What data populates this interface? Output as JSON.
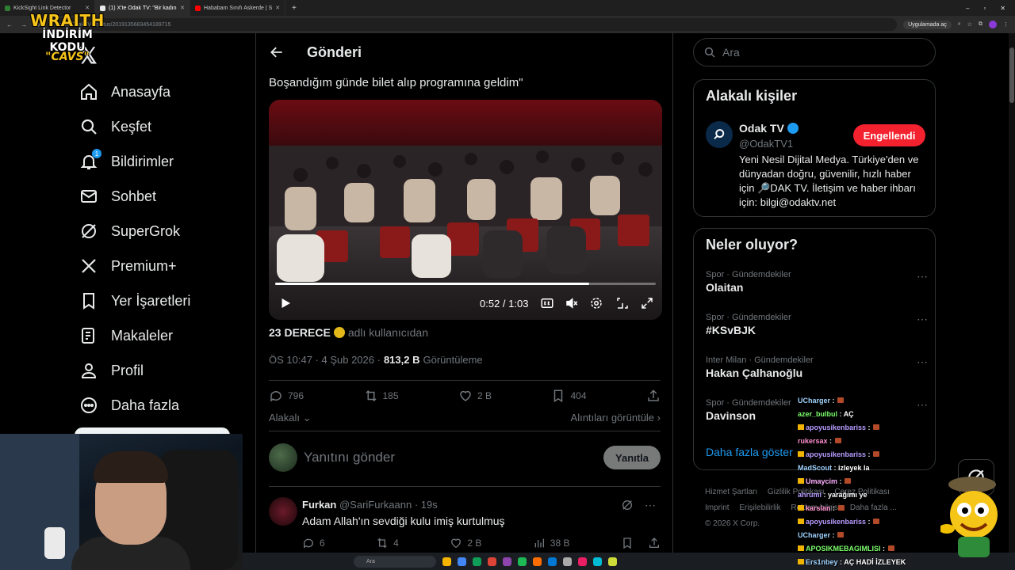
{
  "browser": {
    "tabs": [
      {
        "title": "KickSight Link Detector",
        "color": "#2e7d32",
        "active": false
      },
      {
        "title": "(1) X'te Odak TV: \"Bir kadın",
        "color": "#e7e9ea",
        "active": true
      },
      {
        "title": "Hababam Sınıfı Askerde | S",
        "color": "#ff0000",
        "active": false
      }
    ],
    "url": "x.com/OdakTV1/status/2019135683454189715",
    "app_pill": "Uygulamada aç"
  },
  "overlay_logo": {
    "line1": "WRAITH",
    "line2": "İNDİRİM KODU",
    "line3": "\"CAVS\""
  },
  "nav": {
    "items": [
      {
        "label": "Anasayfa",
        "icon": "home-icon"
      },
      {
        "label": "Keşfet",
        "icon": "search-icon"
      },
      {
        "label": "Bildirimler",
        "icon": "bell-icon",
        "badge": "1"
      },
      {
        "label": "Sohbet",
        "icon": "mail-icon"
      },
      {
        "label": "SuperGrok",
        "icon": "grok-icon"
      },
      {
        "label": "Premium+",
        "icon": "x-logo-icon"
      },
      {
        "label": "Yer İşaretleri",
        "icon": "bookmark-icon"
      },
      {
        "label": "Makaleler",
        "icon": "article-icon"
      },
      {
        "label": "Profil",
        "icon": "person-icon"
      },
      {
        "label": "Daha fazla",
        "icon": "more-circle-icon"
      }
    ]
  },
  "main": {
    "title": "Gönderi",
    "quote_line": "Boşandığım günde bilet alıp programına geldim\"",
    "video": {
      "current_time": "0:52",
      "duration": "1:03",
      "time_display": "0:52 / 1:03",
      "progress": 0.825
    },
    "attribution": {
      "name": "23 DERECE",
      "suffix": "adlı kullanıcıdan"
    },
    "meta": {
      "time": "ÖS 10:47 · 4 Şub 2026 ·",
      "views": "813,2 B",
      "views_label": "Görüntüleme"
    },
    "stats": {
      "replies": "796",
      "reposts": "185",
      "likes": "2 B",
      "bookmarks": "404"
    },
    "sort_label": "Alakalı",
    "quotes_link": "Alıntıları görüntüle",
    "reply_placeholder": "Yanıtını gönder",
    "reply_button": "Yanıtla",
    "comment": {
      "name": "Furkan",
      "handle": "@SariFurkaann · 19s",
      "text": "Adam Allah'ın sevdiği kulu imiş kurtulmuş",
      "replies": "6",
      "reposts": "4",
      "likes": "2 B",
      "views": "38 B"
    }
  },
  "right": {
    "search_placeholder": "Ara",
    "related": {
      "title": "Alakalı kişiler",
      "name": "Odak TV",
      "handle": "@OdakTV1",
      "button": "Engellendi",
      "bio": "Yeni Nesil Dijital Medya. Türkiye'den ve dünyadan doğru, güvenilir, hızlı haber için 🔎DAK TV. İletişim ve haber ihbarı için: bilgi@odaktv.net"
    },
    "trends": {
      "title": "Neler oluyor?",
      "items": [
        {
          "meta": "Spor · Gündemdekiler",
          "name": "Olaitan"
        },
        {
          "meta": "Spor · Gündemdekiler",
          "name": "#KSvBJK"
        },
        {
          "meta": "Inter Milan · Gündemdekiler",
          "name": "Hakan Çalhanoğlu"
        },
        {
          "meta": "Spor · Gündemdekiler",
          "name": "Davinson"
        }
      ],
      "show_more": "Daha fazla göster"
    },
    "footer": {
      "links": [
        "Hizmet Şartları",
        "Gizlilik Politikası",
        "Çerez Politikası",
        "Imprint",
        "Erişilebilirlik",
        "Reklam bilgisi",
        "Daha fazla ..."
      ],
      "copyright": "© 2026 X Corp."
    }
  },
  "chat": [
    {
      "user": "UCharger",
      "color": "#9fd3ff",
      "text": ""
    },
    {
      "user": "azer_bulbul",
      "color": "#7cff6b",
      "text": "AÇ"
    },
    {
      "user": "apoyusikenbariss",
      "color": "#b79cff",
      "text": ""
    },
    {
      "user": "rukersax",
      "color": "#ff8fd0",
      "text": ""
    },
    {
      "user": "apoyusikenbariss",
      "color": "#b79cff",
      "text": ""
    },
    {
      "user": "MadScout",
      "color": "#9fd3ff",
      "text": "izleyek la"
    },
    {
      "user": "Umaycim",
      "color": "#ffb0ff",
      "text": ""
    },
    {
      "user": "ahrumi",
      "color": "#b79cff",
      "text": "yarağımı ye"
    },
    {
      "user": "karslan",
      "color": "#ff8fd0",
      "text": ""
    },
    {
      "user": "apoyusikenbariss",
      "color": "#b79cff",
      "text": ""
    },
    {
      "user": "UCharger",
      "color": "#9fd3ff",
      "text": ""
    },
    {
      "user": "APOSIKMEBAGIMLISI",
      "color": "#7cff6b",
      "text": ""
    },
    {
      "user": "Ers1nbey",
      "color": "#9fd3ff",
      "text": "AÇ HADİ İZLEYEK"
    }
  ],
  "taskbar": {
    "search_placeholder": "Ara",
    "icon_colors": [
      "#f4b400",
      "#4285f4",
      "#0f9d58",
      "#db4437",
      "#8e44ad",
      "#1db954",
      "#ff6d00",
      "#0078d4",
      "#aaaaaa",
      "#e91e63",
      "#00bcd4",
      "#cddc39"
    ]
  }
}
